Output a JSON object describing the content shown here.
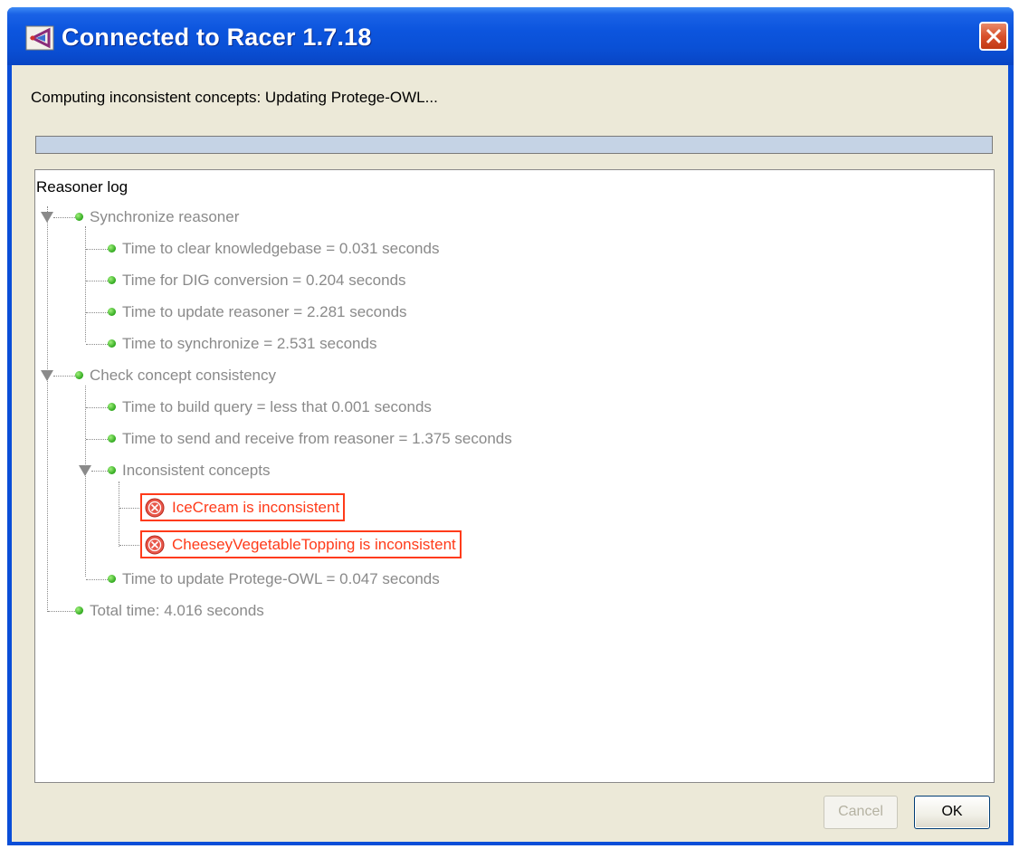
{
  "window": {
    "title": "Connected to Racer 1.7.18"
  },
  "status": {
    "text": "Computing inconsistent concepts: Updating Protege-OWL...",
    "progress_fraction": 1.0
  },
  "log": {
    "title": "Reasoner log",
    "items": [
      "Synchronize reasoner",
      "Time to clear knowledgebase = 0.031 seconds",
      "Time for DIG conversion = 0.204 seconds",
      "Time to update reasoner = 2.281 seconds",
      "Time to synchronize = 2.531 seconds",
      "Check concept consistency",
      "Time to build query = less that 0.001 seconds",
      "Time to send and receive from reasoner = 1.375 seconds",
      "Inconsistent concepts",
      "IceCream is inconsistent",
      "CheeseyVegetableTopping is inconsistent",
      "Time to update Protege-OWL = 0.047 seconds",
      "Total time: 4.016 seconds"
    ]
  },
  "buttons": {
    "cancel": "Cancel",
    "ok": "OK"
  },
  "icons": {
    "app": "protege-app-icon",
    "close": "close-icon",
    "node": "green-dot-icon",
    "expander": "triangle-down-icon",
    "error": "error-x-icon"
  },
  "colors": {
    "title_bar": "#0a50d6",
    "client_bg": "#ece9d8",
    "error": "#ff3b1a",
    "tree_text": "#8a8a8a",
    "progress": "#c5d3e5"
  }
}
